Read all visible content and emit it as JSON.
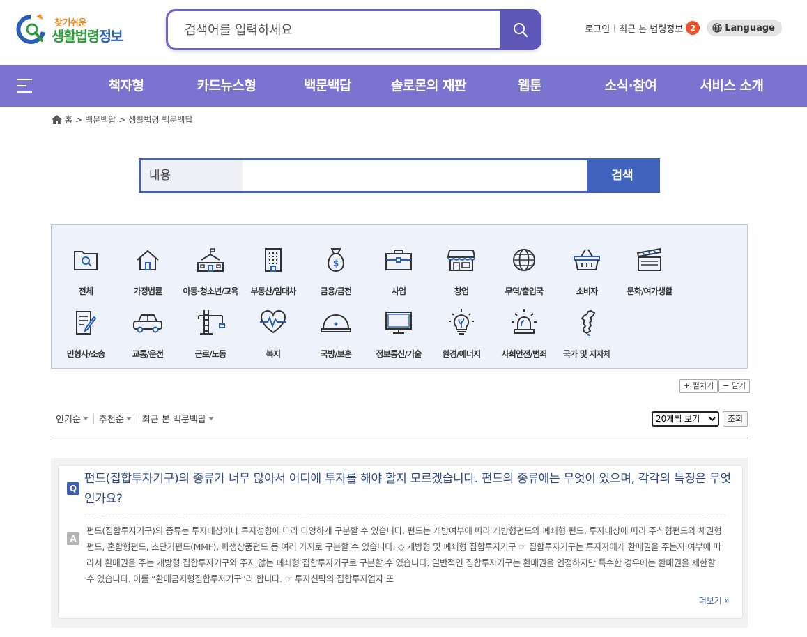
{
  "header": {
    "logo_small": "찾기쉬운",
    "logo_big_green": "생활법령",
    "logo_big_blue": "정보",
    "search_placeholder": "검색어를 입력하세요",
    "login": "로그인",
    "recent_laws": "최근 본 법령정보",
    "recent_count": "2",
    "language": "Language"
  },
  "nav": {
    "items": [
      {
        "label": "책자형"
      },
      {
        "label": "카드뉴스형"
      },
      {
        "label": "백문백답"
      },
      {
        "label": "솔로몬의 재판"
      },
      {
        "label": "웹툰"
      },
      {
        "label": "소식·참여"
      },
      {
        "label": "서비스 소개"
      }
    ]
  },
  "breadcrumb": {
    "home": "홈",
    "sep": ">",
    "level1": "백문백답",
    "level2": "생활법령 백문백답"
  },
  "content_search": {
    "label": "내용",
    "button": "검색"
  },
  "categories": [
    {
      "label": "전체",
      "icon": "folder-search-icon"
    },
    {
      "label": "가정법률",
      "icon": "house-icon"
    },
    {
      "label": "아동·청소년/교육",
      "icon": "school-icon"
    },
    {
      "label": "부동산/임대차",
      "icon": "building-icon"
    },
    {
      "label": "금융/금전",
      "icon": "money-bag-icon"
    },
    {
      "label": "사업",
      "icon": "briefcase-icon"
    },
    {
      "label": "창업",
      "icon": "store-icon"
    },
    {
      "label": "무역/출입국",
      "icon": "globe-icon"
    },
    {
      "label": "소비자",
      "icon": "basket-icon"
    },
    {
      "label": "문화/여가생활",
      "icon": "clapperboard-icon"
    },
    {
      "label": "민형사/소송",
      "icon": "document-pen-icon"
    },
    {
      "label": "교통/운전",
      "icon": "car-icon"
    },
    {
      "label": "근로/노동",
      "icon": "crane-icon"
    },
    {
      "label": "복지",
      "icon": "heart-pulse-icon"
    },
    {
      "label": "국방/보훈",
      "icon": "helmet-icon"
    },
    {
      "label": "정보통신/기술",
      "icon": "monitor-icon"
    },
    {
      "label": "환경/에너지",
      "icon": "lightbulb-icon"
    },
    {
      "label": "사회안전/범죄",
      "icon": "siren-icon"
    },
    {
      "label": "국가 및 지자체",
      "icon": "korea-map-icon"
    }
  ],
  "controls": {
    "expand": "+ 펼치기",
    "collapse": "− 닫기",
    "sort": [
      "인기순",
      "추천순",
      "최근 본 백문백답"
    ],
    "per_page": "20개씩 보기",
    "view": "조회"
  },
  "qa": {
    "q_badge": "Q",
    "a_badge": "A",
    "question": "펀드(집합투자기구)의 종류가 너무 많아서 어디에 투자를 해야 할지 모르겠습니다. 펀드의 종류에는 무엇이 있으며, 각각의 특징은 무엇인가요?",
    "answer": "펀드(집합투자기구)의 종류는 투자대상이나 투자성향에 따라 다양하게 구분할 수 있습니다. 펀드는 개방여부에 따라 개방형펀드와 폐쇄형 펀드, 투자대상에 따라 주식형펀드와 채권형펀드, 혼합형펀드, 초단기펀드(MMF), 파생상품펀드 등 여러 가지로 구분할 수 있습니다. ◇ 개방형 및 폐쇄형 집합투자기구 ☞ 집합투자기구는 투자자에게 환매권을 주는지 여부에 따라서 환매권을 주는 개방형 집합투자기구와 주지 않는 폐쇄형 집합투자기구로 구분할 수 있습니다. 일반적인 집합투자기구는 환매권을 인정하지만 특수한 경우에는 환매권을 제한할 수 있습니다. 이를 “환매금지형집합투자기구”라 합니다. ☞ 투자신탁의 집합투자업자 또",
    "more": "더보기 »"
  }
}
